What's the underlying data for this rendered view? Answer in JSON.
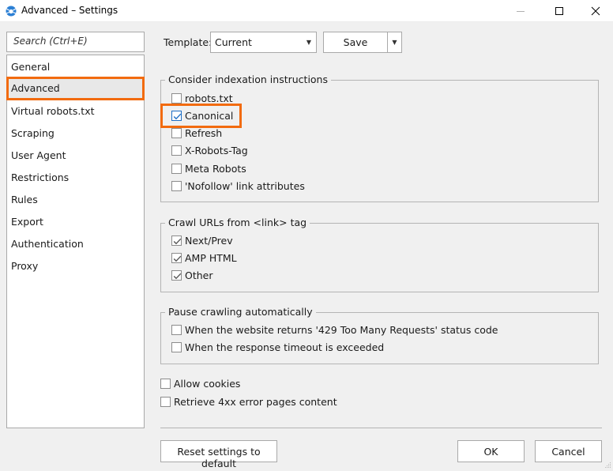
{
  "window": {
    "title": "Advanced – Settings",
    "app_icon": "spider-logo-icon",
    "controls": {
      "minimize": "minimize-icon",
      "maximize": "maximize-icon",
      "close": "close-icon"
    }
  },
  "sidebar": {
    "search_placeholder": "Search (Ctrl+E)",
    "items": [
      {
        "label": "General",
        "selected": false
      },
      {
        "label": "Advanced",
        "selected": true
      },
      {
        "label": "Virtual robots.txt",
        "selected": false
      },
      {
        "label": "Scraping",
        "selected": false
      },
      {
        "label": "User Agent",
        "selected": false
      },
      {
        "label": "Restrictions",
        "selected": false
      },
      {
        "label": "Rules",
        "selected": false
      },
      {
        "label": "Export",
        "selected": false
      },
      {
        "label": "Authentication",
        "selected": false
      },
      {
        "label": "Proxy",
        "selected": false
      }
    ]
  },
  "template": {
    "label": "Template:",
    "selected": "Current",
    "save_label": "Save"
  },
  "groups": {
    "indexation": {
      "title": "Consider indexation instructions",
      "options": [
        {
          "label": "robots.txt",
          "checked": false
        },
        {
          "label": "Canonical",
          "checked": true,
          "highlighted": true
        },
        {
          "label": "Refresh",
          "checked": false
        },
        {
          "label": "X-Robots-Tag",
          "checked": false
        },
        {
          "label": "Meta Robots",
          "checked": false
        },
        {
          "label": "'Nofollow' link attributes",
          "checked": false
        }
      ]
    },
    "link_tag": {
      "title": "Crawl URLs from <link> tag",
      "options": [
        {
          "label": "Next/Prev",
          "checked": true
        },
        {
          "label": "AMP HTML",
          "checked": true
        },
        {
          "label": "Other",
          "checked": true
        }
      ]
    },
    "pause": {
      "title": "Pause crawling automatically",
      "options": [
        {
          "label": "When the website returns '429 Too Many Requests' status code",
          "checked": false
        },
        {
          "label": "When the response timeout is exceeded",
          "checked": false
        }
      ]
    }
  },
  "standalone": [
    {
      "label": "Allow cookies",
      "checked": false
    },
    {
      "label": "Retrieve 4xx error pages content",
      "checked": false
    }
  ],
  "footer": {
    "reset_label": "Reset settings to default",
    "ok_label": "OK",
    "cancel_label": "Cancel"
  },
  "colors": {
    "highlight": "#f26b0f",
    "check_blue": "#1f6fc5",
    "check_grey": "#555555"
  }
}
